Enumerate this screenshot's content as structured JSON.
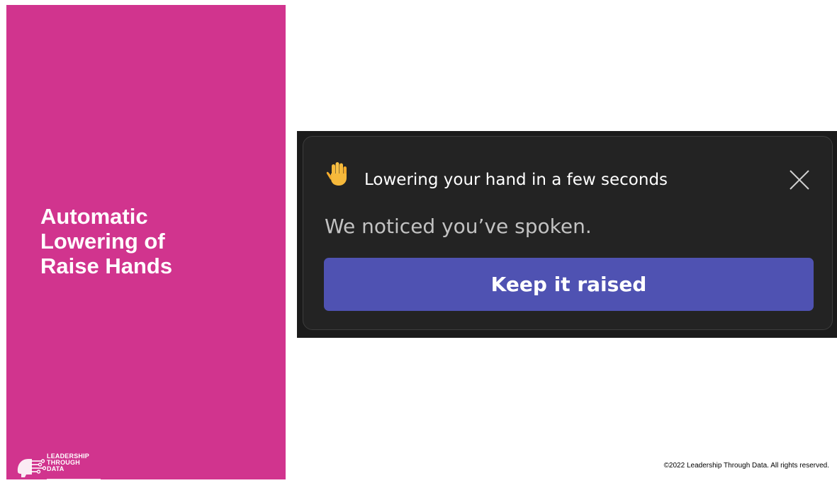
{
  "slide": {
    "title_lines": [
      "Automatic",
      "Lowering of",
      "Raise Hands"
    ],
    "panel_color": "#d1348e",
    "copyright": "©2022 Leadership Through Data. All rights reserved."
  },
  "logo": {
    "lines": [
      "LEADERSHIP",
      "THROUGH",
      "DATA"
    ],
    "icon": "circuit-head-icon"
  },
  "notification": {
    "icon": "raised-hand-icon",
    "title": "Lowering your hand in a few seconds",
    "message": "We noticed you’ve spoken.",
    "button_label": "Keep it raised",
    "close_icon": "close-icon",
    "button_color": "#4f52b2",
    "background_color": "#232323"
  }
}
